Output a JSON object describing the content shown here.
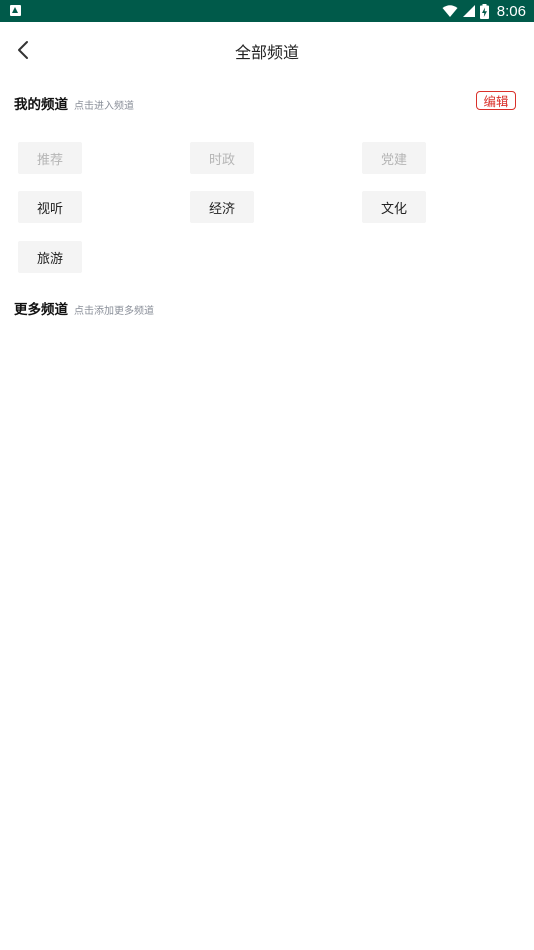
{
  "status_bar": {
    "time": "8:06",
    "icons": [
      "app-notification-icon",
      "wifi-icon",
      "signal-icon",
      "battery-charging-icon"
    ],
    "background_color": "#005a4a"
  },
  "header": {
    "title": "全部频道",
    "back_icon": "chevron-left-icon"
  },
  "my_channels": {
    "title": "我的频道",
    "hint": "点击进入频道",
    "edit_label": "编辑",
    "edit_color": "#d9302a",
    "items": [
      {
        "label": "推荐",
        "fixed": true
      },
      {
        "label": "时政",
        "fixed": true
      },
      {
        "label": "党建",
        "fixed": true
      },
      {
        "label": "视听",
        "fixed": false
      },
      {
        "label": "经济",
        "fixed": false
      },
      {
        "label": "文化",
        "fixed": false
      },
      {
        "label": "旅游",
        "fixed": false
      }
    ]
  },
  "more_channels": {
    "title": "更多频道",
    "hint": "点击添加更多频道"
  }
}
